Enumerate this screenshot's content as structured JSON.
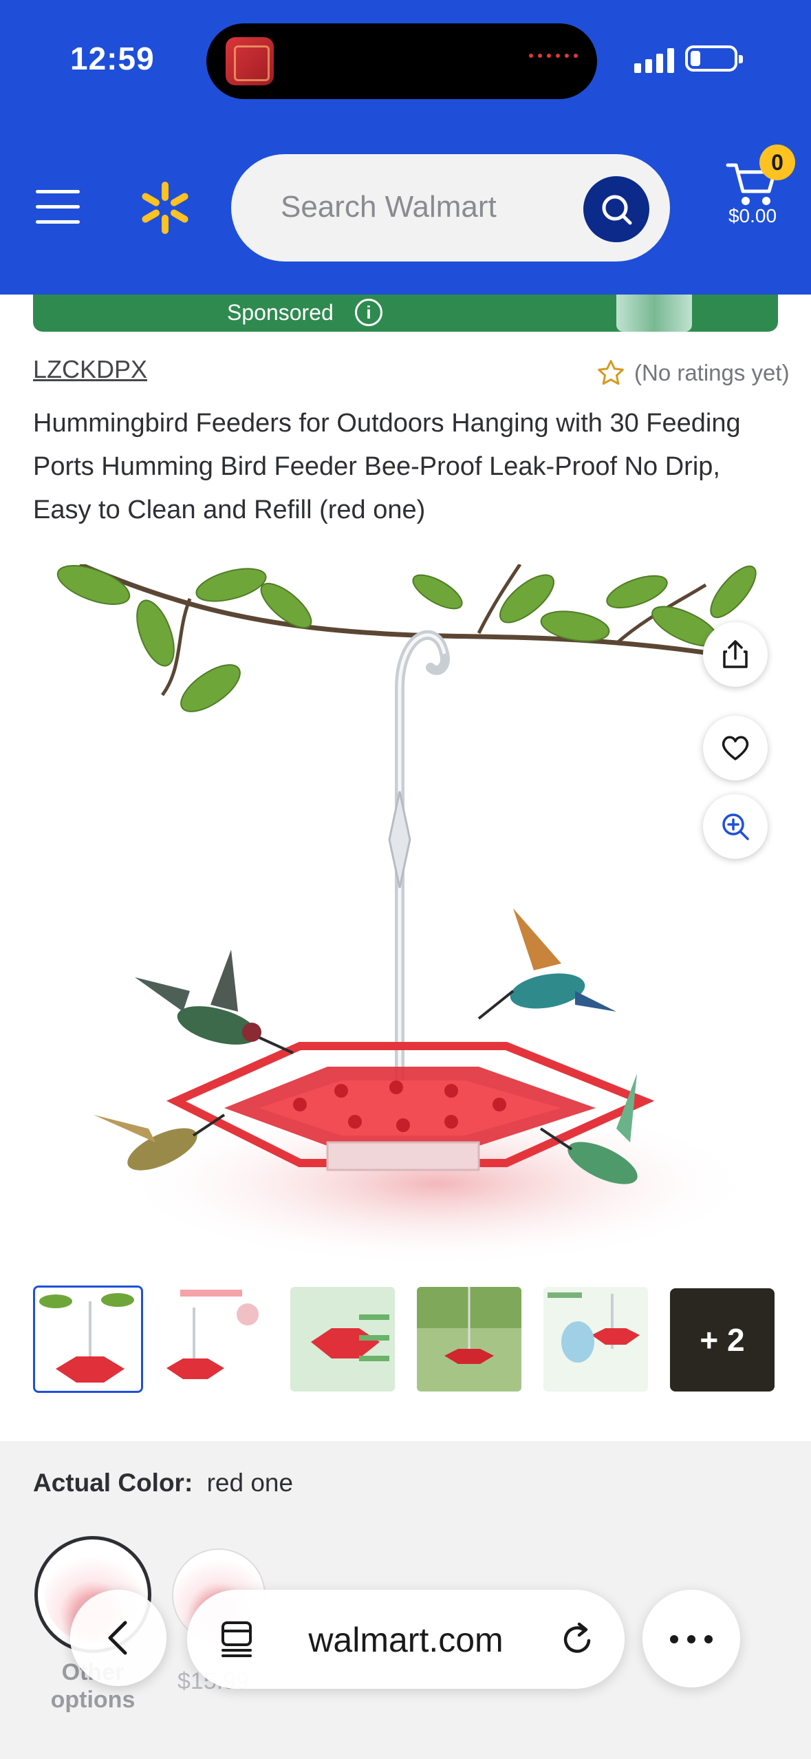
{
  "status_bar": {
    "time": "12:59",
    "signal_icon": "signal-bars-icon",
    "battery_icon": "battery-icon",
    "now_playing_icon": "album-art-icon"
  },
  "header": {
    "menu_icon": "hamburger-menu-icon",
    "logo_icon": "walmart-spark-icon",
    "search_placeholder": "Search Walmart",
    "search_icon": "search-icon",
    "cart_icon": "cart-icon",
    "cart_count": "0",
    "cart_total": "$0.00",
    "brand_color": "#1f4fd8",
    "accent_color": "#ffc220"
  },
  "sponsored": {
    "label": "Sponsored",
    "info_icon": "info-icon",
    "info_glyph": "i"
  },
  "product": {
    "brand": "LZCKDPX",
    "rating_icon": "star-outline-icon",
    "rating_text": "(No ratings yet)",
    "title": "Hummingbird Feeders for Outdoors Hanging with 30 Feeding Ports Humming Bird Feeder Bee-Proof Leak-Proof No Drip, Easy to Clean and Refill (red one)"
  },
  "image_actions": {
    "share_icon": "share-icon",
    "favorite_icon": "heart-icon",
    "zoom_icon": "zoom-in-icon"
  },
  "thumbnails": {
    "more_label": "+ 2"
  },
  "options": {
    "color_label": "Actual Color:",
    "color_value": "red one",
    "option1_label": "Other options",
    "option2_price": "$15.99"
  },
  "browser": {
    "back_icon": "chevron-left-icon",
    "tabs_icon": "tabs-icon",
    "url": "walmart.com",
    "reload_icon": "reload-icon",
    "more_icon": "more-dots-icon"
  }
}
